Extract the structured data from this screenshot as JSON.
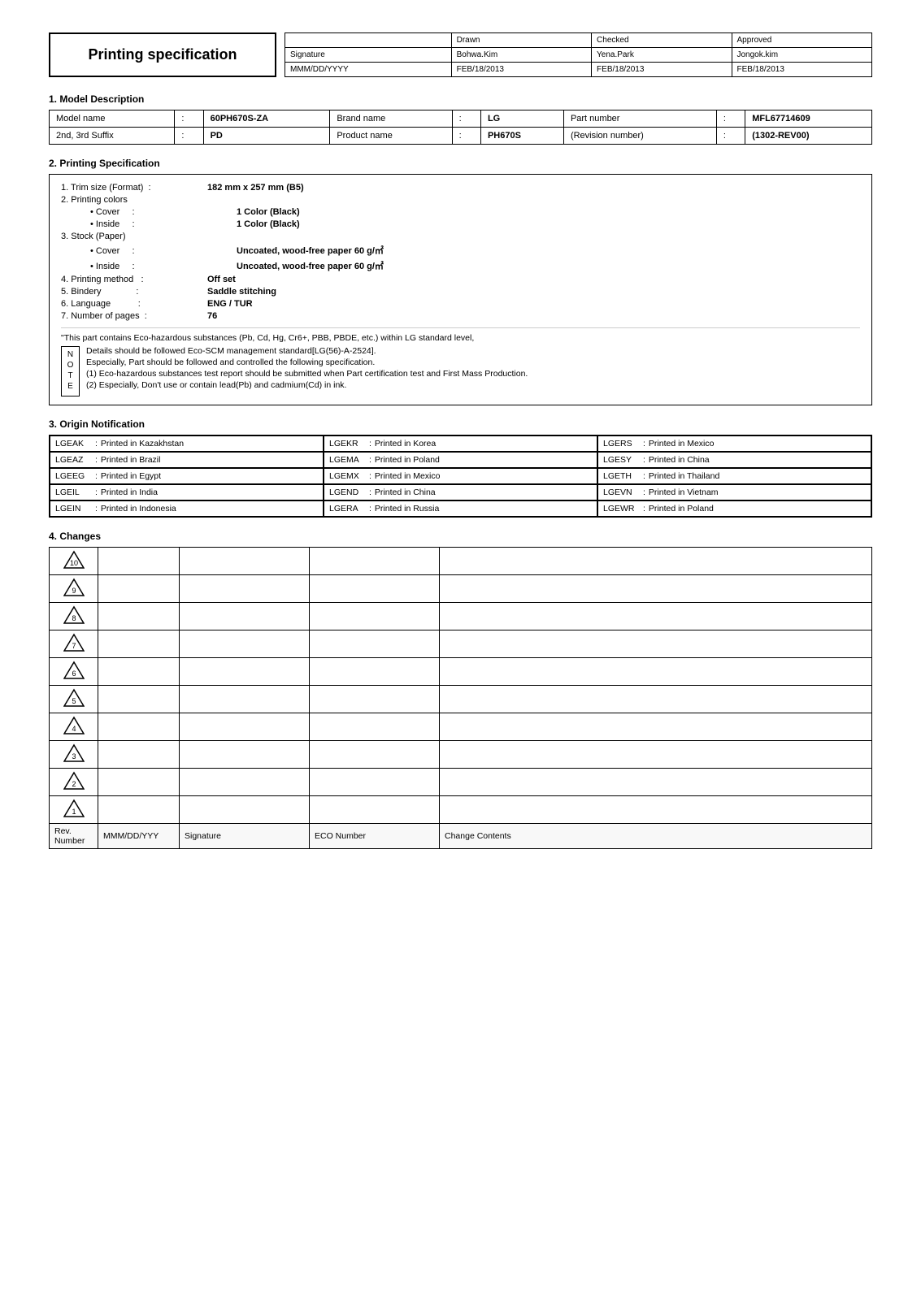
{
  "header": {
    "title": "Printing specification",
    "approval": {
      "columns": [
        "",
        "Drawn",
        "Checked",
        "Approved"
      ],
      "rows": [
        [
          "Signature",
          "Bohwa.Kim",
          "Yena.Park",
          "Jongok.kim"
        ],
        [
          "MMM/DD/YYYY",
          "FEB/18/2013",
          "FEB/18/2013",
          "FEB/18/2013"
        ]
      ]
    }
  },
  "section1": {
    "title": "1. Model Description",
    "rows": [
      {
        "label": "Model name",
        "value": "60PH670S-ZA"
      },
      {
        "label": "Brand name",
        "value": "LG"
      },
      {
        "label": "Part number",
        "value": "MFL67714609"
      },
      {
        "label": "2nd, 3rd Suffix",
        "value": "PD"
      },
      {
        "label": "Product name",
        "value": "PH670S"
      },
      {
        "label": "(Revision number)",
        "value": "(1302-REV00)"
      }
    ]
  },
  "section2": {
    "title": "2. Printing Specification",
    "items": [
      {
        "num": "1.",
        "label": "Trim size (Format)",
        "colon": ":",
        "value": "182 mm x 257 mm (B5)",
        "indent": 0
      },
      {
        "num": "2.",
        "label": "Printing colors",
        "colon": "",
        "value": "",
        "indent": 0
      },
      {
        "num": "",
        "label": "• Cover",
        "colon": ":",
        "value": "1 Color (Black)",
        "indent": 2
      },
      {
        "num": "",
        "label": "• Inside",
        "colon": ":",
        "value": "1 Color (Black)",
        "indent": 2
      },
      {
        "num": "3.",
        "label": "Stock (Paper)",
        "colon": "",
        "value": "",
        "indent": 0
      },
      {
        "num": "",
        "label": "• Cover",
        "colon": ":",
        "value": "Uncoated, wood-free paper 60 g/㎡",
        "indent": 2
      },
      {
        "num": "",
        "label": "• Inside",
        "colon": ":",
        "value": "Uncoated, wood-free paper 60 g/㎡",
        "indent": 2
      },
      {
        "num": "4.",
        "label": "Printing method",
        "colon": ":",
        "value": "Off set",
        "indent": 0
      },
      {
        "num": "5.",
        "label": "Bindery",
        "colon": ":",
        "value": "Saddle stitching",
        "indent": 0
      },
      {
        "num": "6.",
        "label": "Language",
        "colon": ":",
        "value": "ENG / TUR",
        "indent": 0
      },
      {
        "num": "7.",
        "label": "Number of pages",
        "colon": ":",
        "value": "76",
        "indent": 0
      }
    ],
    "notes_header": "\"This part contains Eco-hazardous substances (Pb, Cd, Hg, Cr6+, PBB, PBDE, etc.) within LG standard level,",
    "notes_label": "NOTE",
    "notes": [
      "Details should be followed Eco-SCM management standard[LG(56)-A-2524].",
      "Especially, Part should be followed and controlled the following specification.",
      "(1) Eco-hazardous substances test report should be submitted when Part certification test and First Mass Production.",
      "(2) Especially, Don't use or contain lead(Pb) and cadmium(Cd) in ink."
    ]
  },
  "section3": {
    "title": "3. Origin Notification",
    "origins": [
      {
        "code": "LGEAK",
        "sep": ":",
        "text": "Printed in Kazakhstan"
      },
      {
        "code": "LGEKR",
        "sep": ":",
        "text": "Printed in Korea"
      },
      {
        "code": "LGERS",
        "sep": ":",
        "text": "Printed in Mexico"
      },
      {
        "code": "LGEAZ",
        "sep": ":",
        "text": "Printed in Brazil"
      },
      {
        "code": "LGEMA",
        "sep": ":",
        "text": "Printed in Poland"
      },
      {
        "code": "LGESY",
        "sep": ":",
        "text": "Printed in China"
      },
      {
        "code": "LGEEG",
        "sep": ":",
        "text": "Printed in Egypt"
      },
      {
        "code": "LGEMX",
        "sep": ":",
        "text": "Printed in Mexico"
      },
      {
        "code": "LGETH",
        "sep": ":",
        "text": "Printed in Thailand"
      },
      {
        "code": "LGEIL",
        "sep": ":",
        "text": "Printed in India"
      },
      {
        "code": "LGEND",
        "sep": ":",
        "text": "Printed in China"
      },
      {
        "code": "LGEVN",
        "sep": ":",
        "text": "Printed in Vietnam"
      },
      {
        "code": "LGEIN",
        "sep": ":",
        "text": "Printed in Indonesia"
      },
      {
        "code": "LGERA",
        "sep": ":",
        "text": "Printed in Russia"
      },
      {
        "code": "LGEWR",
        "sep": ":",
        "text": "Printed in Poland"
      }
    ]
  },
  "section4": {
    "title": "4. Changes",
    "rows": [
      10,
      9,
      8,
      7,
      6,
      5,
      4,
      3,
      2,
      1
    ],
    "footer": [
      "Rev. Number",
      "MMM/DD/YYY",
      "Signature",
      "ECO Number",
      "Change Contents"
    ]
  }
}
